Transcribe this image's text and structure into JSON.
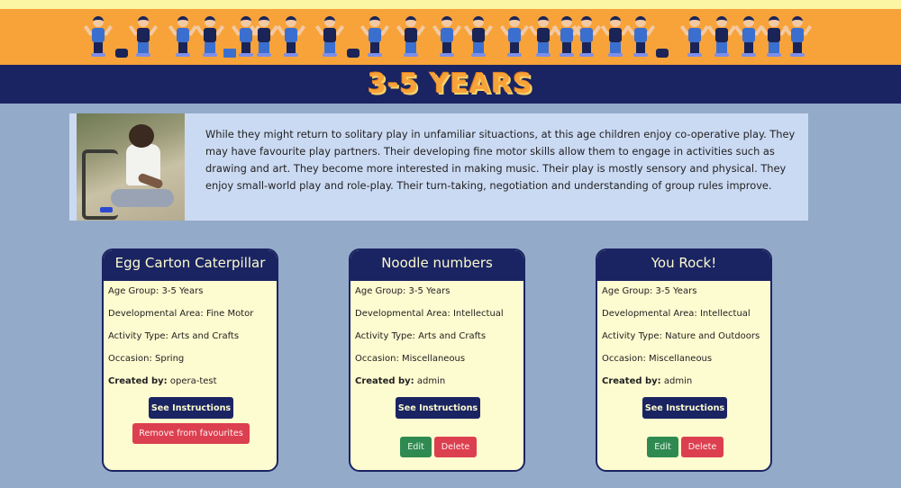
{
  "page": {
    "title": "3-5 YEARS",
    "intro": "While they might return to solitary play in unfamiliar situactions, at this age children enjoy co-operative play. They may have favourite play partners. Their developing fine motor skills allow them to engage in activities such as drawing and art. They become more interested in making music. Their play is mostly sensory and physical. They enjoy small-world play and role-play. Their turn-taking, negotiation and understanding of group rules improve."
  },
  "colors": {
    "banner": "#f7a33a",
    "navy": "#1a2462",
    "background": "#94aac9",
    "card": "#fdfbd0",
    "danger": "#dc3f4f",
    "success": "#2f8a52"
  },
  "labels": {
    "age_group": "Age Group: ",
    "dev_area": "Developmental Area: ",
    "activity_type": "Activity Type: ",
    "occasion": "Occasion: ",
    "created_by": "Created by:",
    "see_instructions": "See Instructions",
    "remove_favourites": "Remove from favourites",
    "edit": "Edit",
    "delete": "Delete"
  },
  "cards": [
    {
      "title": "Egg Carton Caterpillar",
      "age_group": "3-5 Years",
      "dev_area": "Fine Motor",
      "activity_type": "Arts and Crafts",
      "occasion": "Spring",
      "created_by": "opera-test"
    },
    {
      "title": "Noodle numbers",
      "age_group": "3-5 Years",
      "dev_area": "Intellectual",
      "activity_type": "Arts and Crafts",
      "occasion": "Miscellaneous",
      "created_by": "admin"
    },
    {
      "title": "You Rock!",
      "age_group": "3-5 Years",
      "dev_area": "Intellectual",
      "activity_type": "Nature and Outdoors",
      "occasion": "Miscellaneous",
      "created_by": "admin"
    }
  ]
}
